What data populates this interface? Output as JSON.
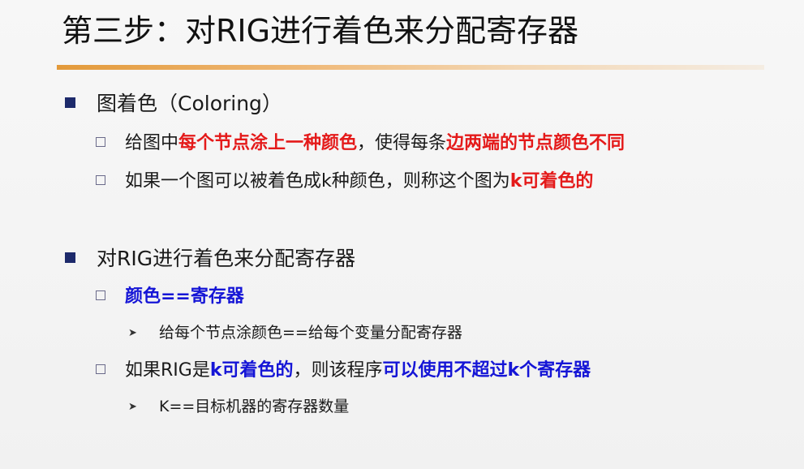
{
  "title": "第三步：对RIG进行着色来分配寄存器",
  "section1": {
    "heading": "图着色（Coloring）",
    "item1": {
      "part1": "给图中",
      "part2": "每个节点涂上一种颜色",
      "part3": "，使得每条",
      "part4": "边两端的节点颜色不同"
    },
    "item2": {
      "part1": "如果一个图可以被着色成k种颜色，则称这个图为",
      "part2": "k可着色的"
    }
  },
  "section2": {
    "heading": "对RIG进行着色来分配寄存器",
    "item1": {
      "label": "颜色==寄存器",
      "sub": "给每个节点涂颜色==给每个变量分配寄存器"
    },
    "item2": {
      "part1": "如果RIG是",
      "part2": "k可着色的",
      "part3": "，则该程序",
      "part4": "可以使用不超过k个寄存器",
      "sub": "K==目标机器的寄存器数量"
    }
  },
  "colors": {
    "red_emphasis": "#e41a1a",
    "blue_emphasis": "#1515d6",
    "bullet_square": "#1d2a6b",
    "title_rule": "#e39a3a"
  },
  "icons": {
    "level1_bullet": "filled-square",
    "level2_bullet": "hollow-square",
    "level3_bullet": "arrowhead"
  }
}
